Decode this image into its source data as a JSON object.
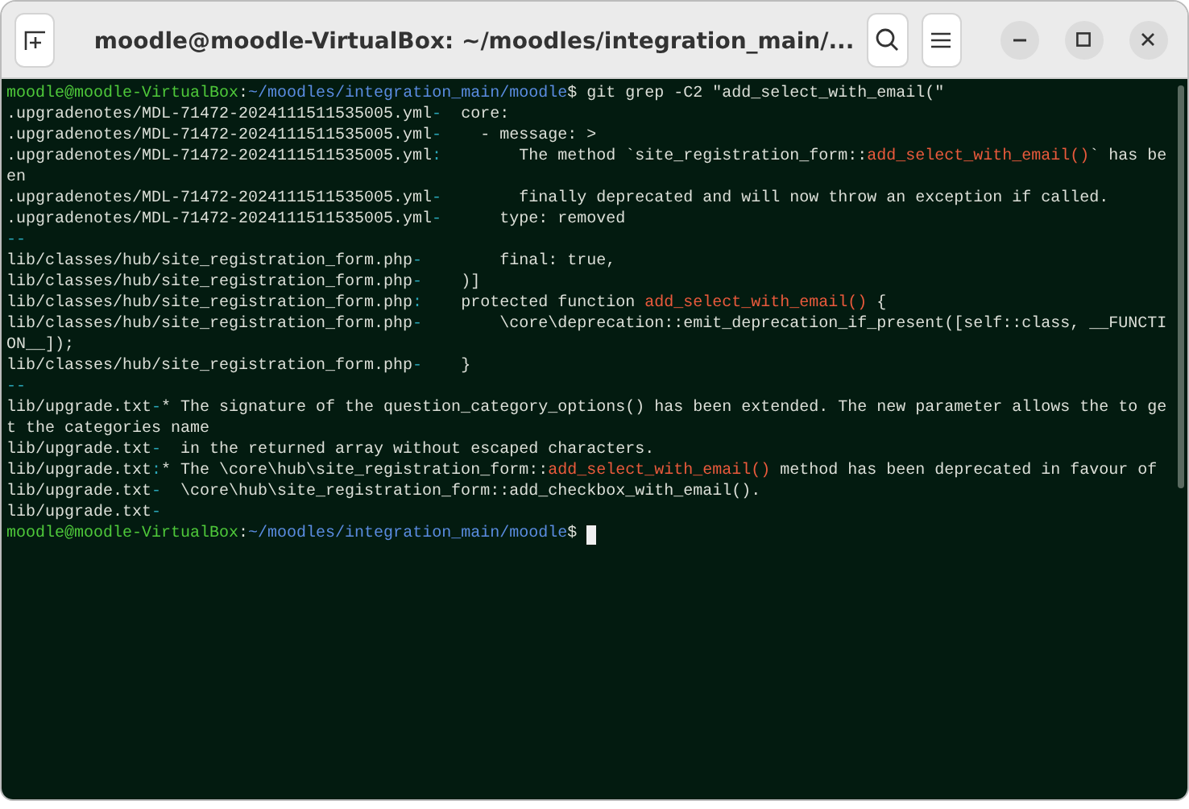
{
  "window": {
    "title": "moodle@moodle-VirtualBox: ~/moodles/integration_main/..."
  },
  "lines": [
    {
      "segments": [
        {
          "kind": "user",
          "text": "moodle@moodle-VirtualBox"
        },
        {
          "kind": "text",
          "text": ":"
        },
        {
          "kind": "path",
          "text": "~/moodles/integration_main/moodle"
        },
        {
          "kind": "text",
          "text": "$ git grep -C2 \"add_select_with_email(\""
        }
      ]
    },
    {
      "segments": [
        {
          "kind": "text",
          "text": ".upgradenotes/MDL-71472-2024111511535005.yml"
        },
        {
          "kind": "sep",
          "text": "-"
        },
        {
          "kind": "text",
          "text": "  core:"
        }
      ]
    },
    {
      "segments": [
        {
          "kind": "text",
          "text": ".upgradenotes/MDL-71472-2024111511535005.yml"
        },
        {
          "kind": "sep",
          "text": "-"
        },
        {
          "kind": "text",
          "text": "    - message: >"
        }
      ]
    },
    {
      "segments": [
        {
          "kind": "text",
          "text": ".upgradenotes/MDL-71472-2024111511535005.yml"
        },
        {
          "kind": "sep",
          "text": ":"
        },
        {
          "kind": "text",
          "text": "        The method `site_registration_form::"
        },
        {
          "kind": "match",
          "text": "add_select_with_email()"
        },
        {
          "kind": "text",
          "text": "` has be"
        }
      ]
    },
    {
      "segments": [
        {
          "kind": "text",
          "text": "en"
        }
      ]
    },
    {
      "segments": [
        {
          "kind": "text",
          "text": ".upgradenotes/MDL-71472-2024111511535005.yml"
        },
        {
          "kind": "sep",
          "text": "-"
        },
        {
          "kind": "text",
          "text": "        finally deprecated and will now throw an exception if called."
        }
      ]
    },
    {
      "segments": [
        {
          "kind": "text",
          "text": ".upgradenotes/MDL-71472-2024111511535005.yml"
        },
        {
          "kind": "sep",
          "text": "-"
        },
        {
          "kind": "text",
          "text": "      type: removed"
        }
      ]
    },
    {
      "segments": [
        {
          "kind": "sep",
          "text": "--"
        }
      ]
    },
    {
      "segments": [
        {
          "kind": "text",
          "text": "lib/classes/hub/site_registration_form.php"
        },
        {
          "kind": "sep",
          "text": "-"
        },
        {
          "kind": "text",
          "text": "        final: true,"
        }
      ]
    },
    {
      "segments": [
        {
          "kind": "text",
          "text": "lib/classes/hub/site_registration_form.php"
        },
        {
          "kind": "sep",
          "text": "-"
        },
        {
          "kind": "text",
          "text": "    )]"
        }
      ]
    },
    {
      "segments": [
        {
          "kind": "text",
          "text": "lib/classes/hub/site_registration_form.php"
        },
        {
          "kind": "sep",
          "text": ":"
        },
        {
          "kind": "text",
          "text": "    protected function "
        },
        {
          "kind": "match",
          "text": "add_select_with_email()"
        },
        {
          "kind": "text",
          "text": " {"
        }
      ]
    },
    {
      "segments": [
        {
          "kind": "text",
          "text": "lib/classes/hub/site_registration_form.php"
        },
        {
          "kind": "sep",
          "text": "-"
        },
        {
          "kind": "text",
          "text": "        \\core\\deprecation::emit_deprecation_if_present([self::class, __FUNCTI"
        }
      ]
    },
    {
      "segments": [
        {
          "kind": "text",
          "text": "ON__]);"
        }
      ]
    },
    {
      "segments": [
        {
          "kind": "text",
          "text": "lib/classes/hub/site_registration_form.php"
        },
        {
          "kind": "sep",
          "text": "-"
        },
        {
          "kind": "text",
          "text": "    }"
        }
      ]
    },
    {
      "segments": [
        {
          "kind": "sep",
          "text": "--"
        }
      ]
    },
    {
      "segments": [
        {
          "kind": "text",
          "text": "lib/upgrade.txt"
        },
        {
          "kind": "sep",
          "text": "-"
        },
        {
          "kind": "text",
          "text": "* The signature of the question_category_options() has been extended. The new parameter allows the to ge"
        }
      ]
    },
    {
      "segments": [
        {
          "kind": "text",
          "text": "t the categories name"
        }
      ]
    },
    {
      "segments": [
        {
          "kind": "text",
          "text": "lib/upgrade.txt"
        },
        {
          "kind": "sep",
          "text": "-"
        },
        {
          "kind": "text",
          "text": "  in the returned array without escaped characters."
        }
      ]
    },
    {
      "segments": [
        {
          "kind": "text",
          "text": "lib/upgrade.txt"
        },
        {
          "kind": "sep",
          "text": ":"
        },
        {
          "kind": "text",
          "text": "* The \\core\\hub\\site_registration_form::"
        },
        {
          "kind": "match",
          "text": "add_select_with_email()"
        },
        {
          "kind": "text",
          "text": " method has been deprecated in favour of"
        }
      ]
    },
    {
      "segments": [
        {
          "kind": "text",
          "text": "lib/upgrade.txt"
        },
        {
          "kind": "sep",
          "text": "-"
        },
        {
          "kind": "text",
          "text": "  \\core\\hub\\site_registration_form::add_checkbox_with_email()."
        }
      ]
    },
    {
      "segments": [
        {
          "kind": "text",
          "text": "lib/upgrade.txt"
        },
        {
          "kind": "sep",
          "text": "-"
        }
      ]
    },
    {
      "segments": [
        {
          "kind": "user",
          "text": "moodle@moodle-VirtualBox"
        },
        {
          "kind": "text",
          "text": ":"
        },
        {
          "kind": "path",
          "text": "~/moodles/integration_main/moodle"
        },
        {
          "kind": "text",
          "text": "$ "
        }
      ],
      "cursor": true
    }
  ]
}
